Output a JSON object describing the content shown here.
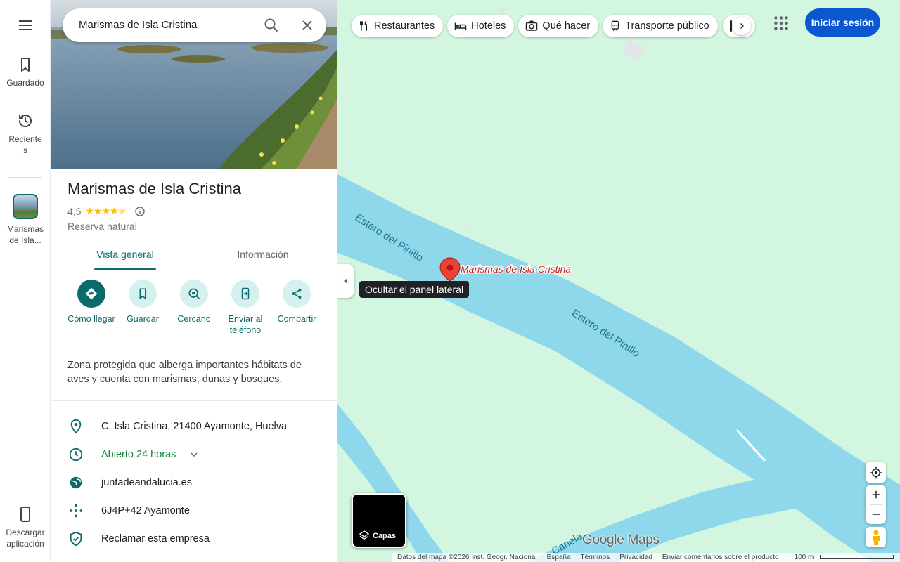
{
  "rail": {
    "saved": "Guardado",
    "recents": "Reciente\ns",
    "place": "Marismas de Isla...",
    "download": "Descargar aplicación"
  },
  "search": {
    "value": "Marismas de Isla Cristina"
  },
  "place": {
    "title": "Marismas de Isla Cristina",
    "rating": "4,5",
    "stars": "★★★★",
    "category": "Reserva natural",
    "description": "Zona protegida que alberga importantes hábitats de aves y cuenta con marismas, dunas y bosques."
  },
  "tabs": {
    "overview": "Vista general",
    "info": "Información"
  },
  "actions": {
    "directions": "Cómo llegar",
    "save": "Guardar",
    "nearby": "Cercano",
    "send": "Enviar al teléfono",
    "share": "Compartir"
  },
  "info": {
    "address": "C. Isla Cristina, 21400 Ayamonte, Huelva",
    "hours": "Abierto 24 horas",
    "website": "juntadeandalucia.es",
    "pluscode": "6J4P+42 Ayamonte",
    "claim": "Reclamar esta empresa"
  },
  "tooltip": "Ocultar el panel lateral",
  "chips": {
    "restaurants": "Restaurantes",
    "hotels": "Hoteles",
    "todo": "Qué hacer",
    "transit": "Transporte público"
  },
  "signin": "Iniciar sesión",
  "layers": "Capas",
  "map": {
    "label_river_1": "Estero del Pinillo",
    "label_river_2": "Estero del Pinillo",
    "label_canal": "Canela",
    "pin_label": "Marismas de Isla Cristina",
    "logo": "Google Maps"
  },
  "footer": {
    "data": "Datos del mapa ©2026 Inst. Geogr. Nacional",
    "country": "España",
    "terms": "Términos",
    "privacy": "Privacidad",
    "feedback": "Enviar comentarios sobre el producto",
    "scale": "100 m"
  },
  "colors": {
    "accent": "#0b6b6b",
    "water": "#8fd8ec",
    "land": "#d3f6e0",
    "signin": "#0b57d0",
    "pin": "#ea4335"
  }
}
